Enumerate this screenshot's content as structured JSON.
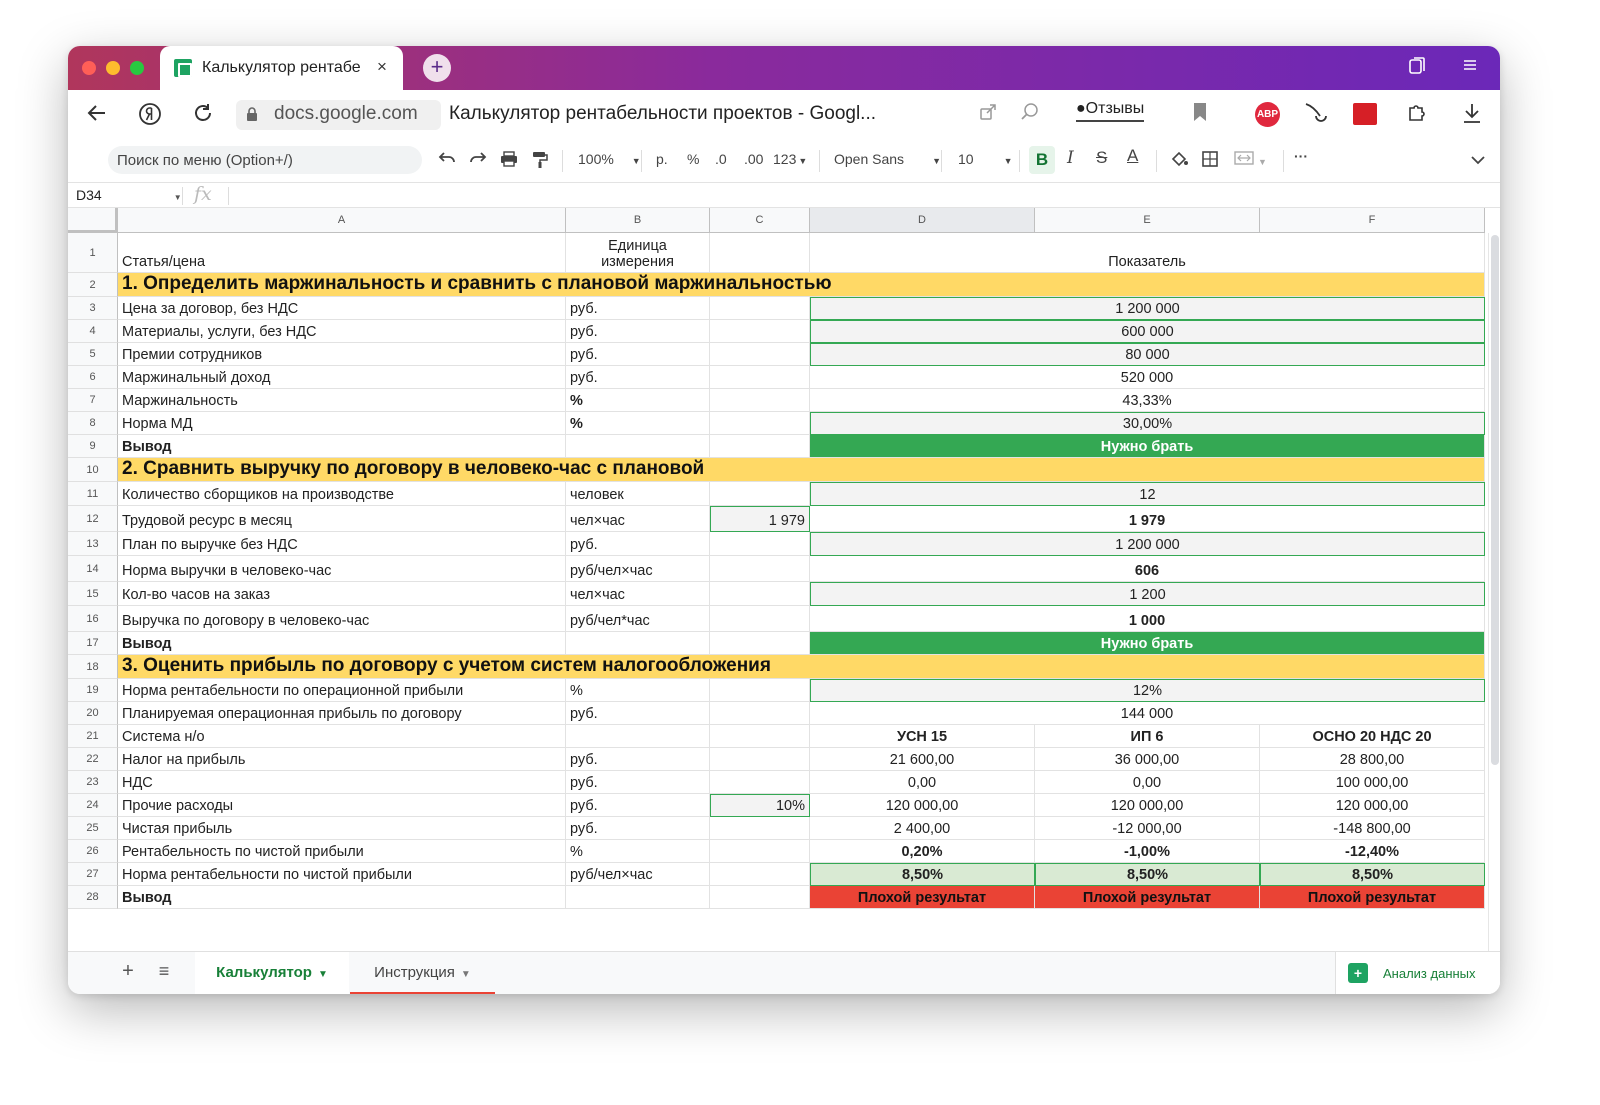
{
  "browser": {
    "tab_title": "Калькулятор рентабе",
    "tab_close": "×",
    "new_tab": "+",
    "url": "docs.google.com",
    "page_title": "Калькулятор рентабельности проектов - Googl...",
    "reviews_label": "Отзывы",
    "abp_label": "ABP"
  },
  "toolbar": {
    "menu_search_placeholder": "Поиск по меню (Option+/)",
    "zoom": "100%",
    "currency": "р.",
    "percent": "%",
    "dec_decrease": ".0",
    "dec_increase": ".00",
    "format_more": "123",
    "font": "Open Sans",
    "font_size": "10",
    "bold": "B",
    "italic": "I",
    "strike": "S",
    "text_color": "A",
    "more": "···"
  },
  "formula_bar": {
    "name_box": "D34",
    "fx": "fx"
  },
  "columns": [
    "A",
    "B",
    "C",
    "D",
    "E",
    "F"
  ],
  "rows": [
    {
      "n": "1",
      "a": "Статья/цена",
      "b": "Единица измерения",
      "c": "",
      "d": "Показатель",
      "type": "header"
    },
    {
      "n": "2",
      "a": "1. Определить маржинальность и сравнить с плановой маржинальностью",
      "type": "section"
    },
    {
      "n": "3",
      "a": "Цена за договор, без НДС",
      "b": "руб.",
      "c": "",
      "d": "1 200 000",
      "type": "input"
    },
    {
      "n": "4",
      "a": "Материалы, услуги, без НДС",
      "b": "руб.",
      "c": "",
      "d": "600 000",
      "type": "input"
    },
    {
      "n": "5",
      "a": "Премии сотрудников",
      "b": "руб.",
      "c": "",
      "d": "80 000",
      "type": "input"
    },
    {
      "n": "6",
      "a": "Маржинальный доход",
      "b": "руб.",
      "c": "",
      "d": "520 000",
      "type": "plain"
    },
    {
      "n": "7",
      "a": "Маржинальность",
      "b": "%",
      "c": "",
      "d": "43,33%",
      "type": "plain",
      "bold_b": true
    },
    {
      "n": "8",
      "a": "Норма МД",
      "b": "%",
      "c": "",
      "d": "30,00%",
      "type": "input",
      "bold_b": true
    },
    {
      "n": "9",
      "a": "Вывод",
      "b": "",
      "c": "",
      "d": "Нужно брать",
      "type": "green"
    },
    {
      "n": "10",
      "a": "2. Сравнить выручку по договору в человеко-час с плановой",
      "type": "section"
    },
    {
      "n": "11",
      "a": "Количество сборщиков на производстве",
      "b": "человек",
      "c": "",
      "d": "12",
      "type": "input"
    },
    {
      "n": "12",
      "a": "Трудовой ресурс в месяц",
      "b": "чел×час",
      "c": "1 979",
      "d": "1 979",
      "type": "plain",
      "bold_d": true
    },
    {
      "n": "13",
      "a": "План по выручке без НДС",
      "b": "руб.",
      "c": "",
      "d": "1 200 000",
      "type": "input"
    },
    {
      "n": "14",
      "a": "Норма выручки в человеко-час",
      "b": "руб/чел×час",
      "c": "",
      "d": "606",
      "type": "plain",
      "bold_d": true
    },
    {
      "n": "15",
      "a": "Кол-во часов на заказ",
      "b": "чел×час",
      "c": "",
      "d": "1 200",
      "type": "input"
    },
    {
      "n": "16",
      "a": "Выручка по договору в человеко-час",
      "b": "руб/чел*час",
      "c": "",
      "d": "1 000",
      "type": "plain",
      "bold_d": true
    },
    {
      "n": "17",
      "a": "Вывод",
      "b": "",
      "c": "",
      "d": "Нужно брать",
      "type": "green"
    },
    {
      "n": "18",
      "a": "3. Оценить прибыль по договору с учетом систем налогообложения",
      "type": "section"
    },
    {
      "n": "19",
      "a": "Норма рентабельности по операционной прибыли",
      "b": "%",
      "c": "",
      "d": "12%",
      "type": "input"
    },
    {
      "n": "20",
      "a": "Планируемая операционная  прибыль по договору",
      "b": "руб.",
      "c": "",
      "d": "144 000",
      "type": "plain"
    },
    {
      "n": "21",
      "a": "Система н/о",
      "b": "",
      "c": "",
      "d": "УСН 15",
      "e": "ИП 6",
      "f": "ОСНО 20 НДС 20",
      "type": "split",
      "bold": true
    },
    {
      "n": "22",
      "a": "Налог на прибыль",
      "b": "руб.",
      "c": "",
      "d": "21 600,00",
      "e": "36 000,00",
      "f": "28 800,00",
      "type": "split"
    },
    {
      "n": "23",
      "a": "НДС",
      "b": "руб.",
      "c": "",
      "d": "0,00",
      "e": "0,00",
      "f": "100 000,00",
      "type": "split"
    },
    {
      "n": "24",
      "a": "Прочие расходы",
      "b": "руб.",
      "c": "10%",
      "d": "120 000,00",
      "e": "120 000,00",
      "f": "120 000,00",
      "type": "split"
    },
    {
      "n": "25",
      "a": "Чистая прибыль",
      "b": "руб.",
      "c": "",
      "d": "2 400,00",
      "e": "-12 000,00",
      "f": "-148 800,00",
      "type": "split"
    },
    {
      "n": "26",
      "a": "Рентабельность по чистой прибыли",
      "b": "%",
      "c": "",
      "d": "0,20%",
      "e": "-1,00%",
      "f": "-12,40%",
      "type": "split",
      "bold": true
    },
    {
      "n": "27",
      "a": "Норма рентабельности по чистой прибыли",
      "b": "руб/чел×час",
      "c": "",
      "d": "8,50%",
      "e": "8,50%",
      "f": "8,50%",
      "type": "lgreen"
    },
    {
      "n": "28",
      "a": "Вывод",
      "b": "",
      "c": "",
      "d": "Плохой результат",
      "e": "Плохой результат",
      "f": "Плохой результат",
      "type": "red"
    }
  ],
  "sheet_tabs": {
    "add": "+",
    "list": "≡",
    "tabs": [
      "Калькулятор",
      "Инструкция"
    ],
    "analysis": "Анализ данных"
  },
  "colors": {
    "section": "#ffd966",
    "ok_green": "#34a853",
    "bad_red": "#ea4335",
    "target_green": "#d9ead3"
  }
}
